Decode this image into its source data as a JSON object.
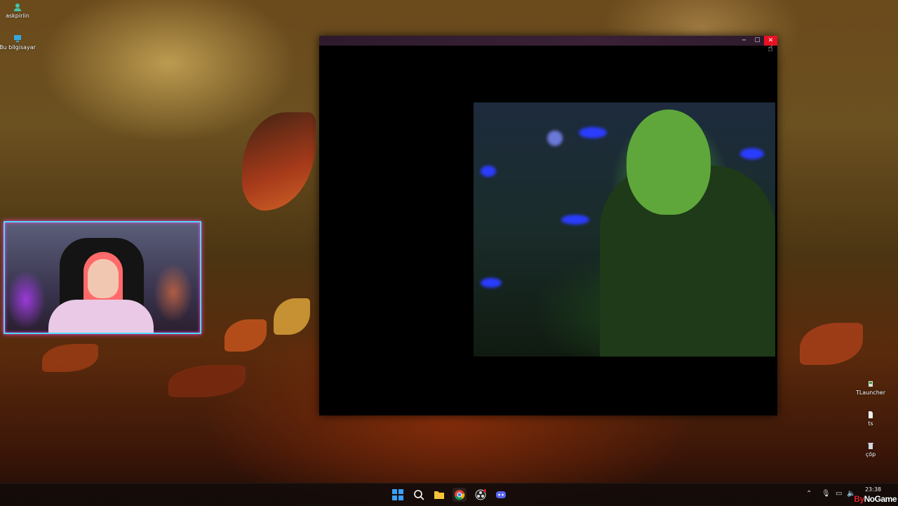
{
  "desktop": {
    "icons_left": [
      {
        "label": "askpiriin",
        "icon": "user-icon"
      },
      {
        "label": "Bu bilgisayar",
        "icon": "computer-icon"
      }
    ],
    "icons_right": [
      {
        "label": "TLauncher",
        "icon": "app-icon"
      },
      {
        "label": "ts",
        "icon": "file-icon"
      },
      {
        "label": "çöp",
        "icon": "recycle-bin-icon"
      }
    ]
  },
  "window": {
    "controls": {
      "minimize": "─",
      "maximize": "☐",
      "close": "✕"
    }
  },
  "taskbar": {
    "apps": [
      {
        "name": "start",
        "icon": "windows-icon"
      },
      {
        "name": "search",
        "icon": "search-icon"
      },
      {
        "name": "explorer",
        "icon": "folder-icon"
      },
      {
        "name": "chrome",
        "icon": "chrome-icon"
      },
      {
        "name": "obs",
        "icon": "obs-icon"
      },
      {
        "name": "discord",
        "icon": "discord-icon"
      }
    ],
    "clock_time": "23:38"
  },
  "watermark": {
    "prefix": "By",
    "rest": "NoGame"
  },
  "colors": {
    "close_button": "#e81123",
    "webcam_border": "#4fd8ff",
    "taskbar": "#140c0a"
  }
}
